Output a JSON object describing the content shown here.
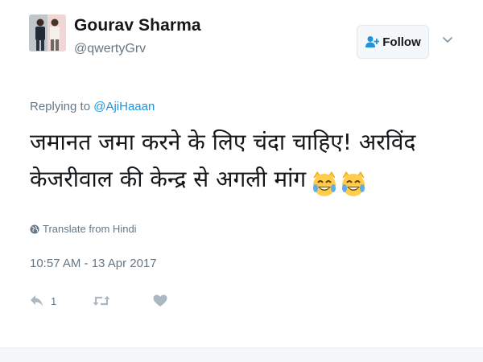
{
  "user": {
    "name": "Gourav Sharma",
    "handle": "@qwertyGrv"
  },
  "follow": {
    "label": "Follow"
  },
  "reply_context": {
    "prefix": "Replying to",
    "mention": "@AjiHaaan"
  },
  "tweet": {
    "line1": "जमानत जमा करने के लिए चंदा चाहिए! अरविंद",
    "line2": "केजरीवाल की केन्द्र से अगली मांग",
    "emoji": [
      "face-with-tears-of-joy-icon",
      "face-with-tears-of-joy-icon"
    ]
  },
  "translate": {
    "label": "Translate from Hindi"
  },
  "timestamp": "10:57 AM - 13 Apr 2017",
  "actions": {
    "reply_count": "1",
    "retweet_count": "",
    "like_count": ""
  },
  "colors": {
    "text": "#14171a",
    "muted": "#657786",
    "link": "#1b95e0",
    "action_icon": "#aab8c2"
  }
}
